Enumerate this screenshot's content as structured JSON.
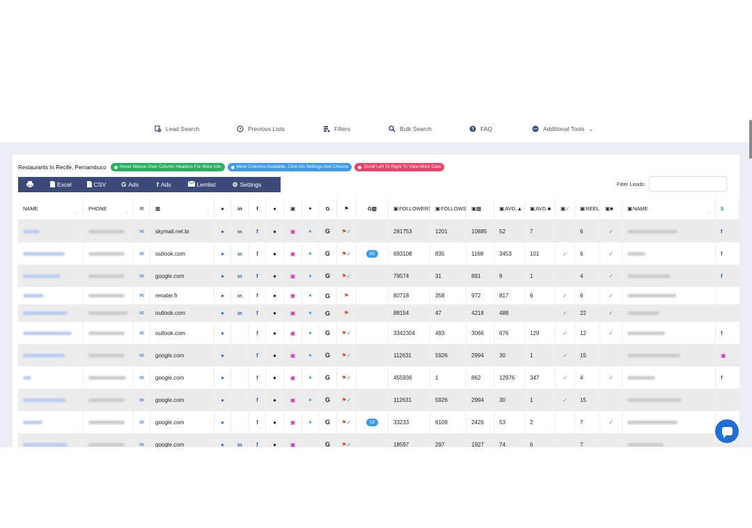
{
  "nav": {
    "items": [
      {
        "label": "Lead Search",
        "icon": "search-list-icon"
      },
      {
        "label": "Previous Lists",
        "icon": "history-icon"
      },
      {
        "label": "Filters",
        "icon": "filter-icon"
      },
      {
        "label": "Bulk Search",
        "icon": "search-icon"
      },
      {
        "label": "FAQ",
        "icon": "question-icon"
      },
      {
        "label": "Additional Tools",
        "icon": "more-icon"
      }
    ]
  },
  "card": {
    "title": "Restaurants In Recife, Pernambuco",
    "pill_hover": "Hover Mouse Over Column Headers For More Info",
    "pill_more": "More Columns Available. Click On Settings And Choose",
    "pill_scroll": "Scroll Left To Right To View More Data"
  },
  "toolbar": {
    "excel": "Excel",
    "csv": "CSV",
    "gads": "Ads",
    "fads": "Ads",
    "lemlist": "Lemlist",
    "settings": "Settings"
  },
  "filter": {
    "label": "Filter Leads:"
  },
  "table": {
    "headers": {
      "name": "NAME",
      "phone": "PHONE",
      "followers": "FOLLOWERS",
      "follows": "FOLLOWS",
      "avg_likes": "AVG.",
      "avg_comments": "AVG.",
      "reel": "REEL",
      "ig_name": "NAME"
    },
    "rows": [
      {
        "domain": "skymail.net.br",
        "web": true,
        "li": true,
        "fb": true,
        "msg": true,
        "ig": true,
        "tw": true,
        "g": true,
        "ads": "both",
        "badge": "",
        "followers": "281753",
        "follows": "1201",
        "posts": "10885",
        "avg_likes": "52",
        "avg_comments": "7",
        "verified": false,
        "reel": "6",
        "business": true,
        "fbcol": true
      },
      {
        "domain": "outlook.com",
        "web": true,
        "li": true,
        "fb": true,
        "msg": true,
        "ig": true,
        "tw": true,
        "g": true,
        "ads": "both",
        "badge": "60",
        "followers": "693108",
        "follows": "835",
        "posts": "1168",
        "avg_likes": "3453",
        "avg_comments": "101",
        "verified": true,
        "reel": "6",
        "business": true,
        "fbcol": true
      },
      {
        "domain": "google.com",
        "web": true,
        "li": true,
        "fb": true,
        "msg": true,
        "ig": true,
        "tw": true,
        "g": true,
        "ads": "both",
        "badge": "",
        "followers": "79574",
        "follows": "31",
        "posts": "891",
        "avg_likes": "9",
        "avg_comments": "1",
        "verified": false,
        "reel": "4",
        "business": true,
        "fbcol": true
      },
      {
        "domain": "renater.fr",
        "web": true,
        "li": true,
        "fb": true,
        "msg": true,
        "ig": true,
        "tw": true,
        "g": true,
        "ads": "red",
        "badge": "",
        "followers": "80718",
        "follows": "358",
        "posts": "972",
        "avg_likes": "817",
        "avg_comments": "6",
        "verified": true,
        "reel": "6",
        "business": true,
        "fbcol": false
      },
      {
        "domain": "outlook.com",
        "web": true,
        "li": true,
        "fb": true,
        "msg": true,
        "ig": true,
        "tw": true,
        "g": true,
        "ads": "red",
        "badge": "",
        "followers": "88154",
        "follows": "47",
        "posts": "4218",
        "avg_likes": "488",
        "avg_comments": "",
        "verified": true,
        "reel": "22",
        "business": true,
        "fbcol": false
      },
      {
        "domain": "outlook.com",
        "web": true,
        "li": false,
        "fb": true,
        "msg": true,
        "ig": true,
        "tw": true,
        "g": true,
        "ads": "both",
        "badge": "",
        "followers": "3342304",
        "follows": "493",
        "posts": "3066",
        "avg_likes": "676",
        "avg_comments": "129",
        "verified": true,
        "reel": "12",
        "business": true,
        "fbcol": true
      },
      {
        "domain": "google.com",
        "web": true,
        "li": false,
        "fb": true,
        "msg": true,
        "ig": true,
        "tw": true,
        "g": true,
        "ads": "both",
        "badge": "",
        "followers": "112631",
        "follows": "5926",
        "posts": "2994",
        "avg_likes": "30",
        "avg_comments": "1",
        "verified": true,
        "reel": "15",
        "business": false,
        "fbcol": "ig"
      },
      {
        "domain": "google.com",
        "web": true,
        "li": false,
        "fb": true,
        "msg": true,
        "ig": true,
        "tw": true,
        "g": true,
        "ads": "both",
        "badge": "",
        "followers": "455936",
        "follows": "1",
        "posts": "862",
        "avg_likes": "12976",
        "avg_comments": "347",
        "verified": true,
        "reel": "4",
        "business": true,
        "fbcol": true
      },
      {
        "domain": "google.com",
        "web": true,
        "li": false,
        "fb": true,
        "msg": true,
        "ig": true,
        "tw": true,
        "g": true,
        "ads": "both",
        "badge": "",
        "followers": "112631",
        "follows": "5926",
        "posts": "2994",
        "avg_likes": "30",
        "avg_comments": "1",
        "verified": true,
        "reel": "15",
        "business": false,
        "fbcol": false
      },
      {
        "domain": "google.com",
        "web": true,
        "li": false,
        "fb": true,
        "msg": true,
        "ig": true,
        "tw": true,
        "g": true,
        "ads": "both",
        "badge": "15",
        "followers": "33233",
        "follows": "6109",
        "posts": "2426",
        "avg_likes": "53",
        "avg_comments": "2",
        "verified": false,
        "reel": "7",
        "business": true,
        "fbcol": false
      },
      {
        "domain": "google.com",
        "web": true,
        "li": true,
        "fb": true,
        "msg": true,
        "ig": true,
        "tw": false,
        "g": true,
        "ads": "both",
        "badge": "",
        "followers": "18597",
        "follows": "297",
        "posts": "1927",
        "avg_likes": "74",
        "avg_comments": "6",
        "verified": false,
        "reel": "7",
        "business": false,
        "fbcol": false
      }
    ]
  },
  "colors": {
    "accent": "#3b4a7a",
    "pill_green": "#27ae60",
    "pill_blue": "#3d9be9",
    "pill_red": "#e9436a",
    "chat": "#1f6fd6"
  }
}
